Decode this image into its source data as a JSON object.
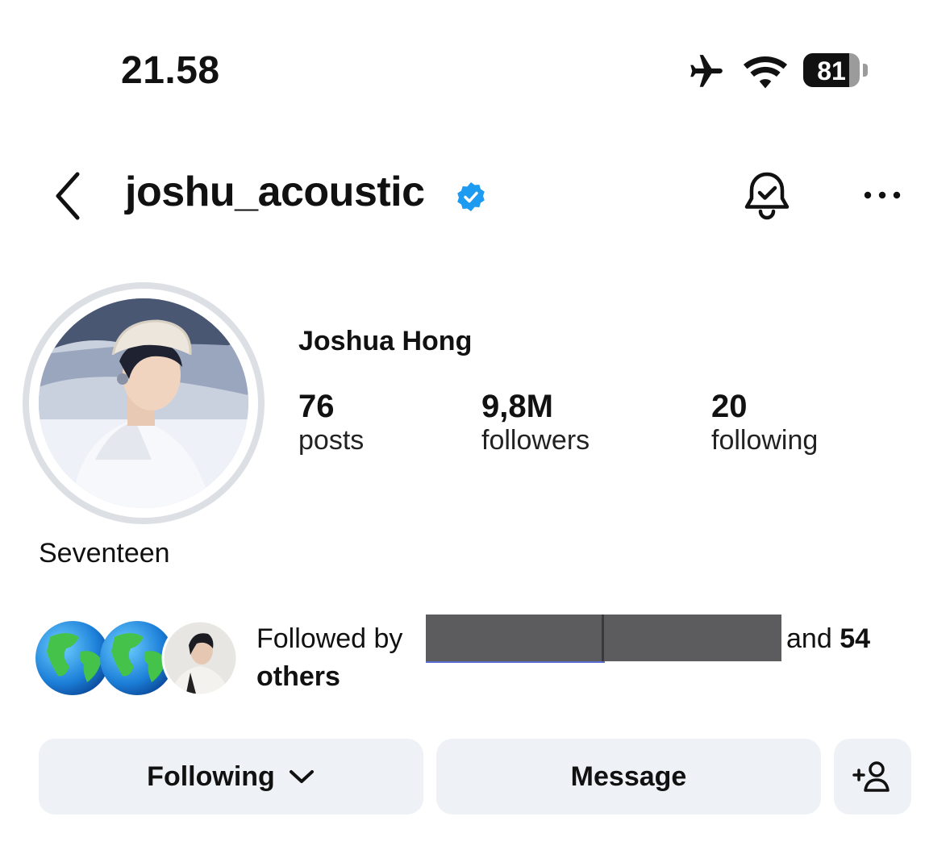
{
  "status_bar": {
    "time": "21.58",
    "battery_level": "81",
    "icons": [
      "airplane-icon",
      "wifi-icon",
      "battery-icon"
    ]
  },
  "header": {
    "username": "joshu_acoustic",
    "verified": true,
    "icons": [
      "back-chevron-icon",
      "verified-badge-icon",
      "notification-bell-icon",
      "more-options-icon"
    ]
  },
  "profile": {
    "name": "Joshua Hong",
    "bio": "Seventeen",
    "stats": [
      {
        "value": "76",
        "label": "posts"
      },
      {
        "value": "9,8M",
        "label": "followers"
      },
      {
        "value": "20",
        "label": "following"
      }
    ]
  },
  "followed_by": {
    "prefix": "Followed by",
    "and_text": "and",
    "count": "54",
    "others": "others",
    "avatars": [
      "globe-icon",
      "globe-icon",
      "user-photo"
    ]
  },
  "actions": {
    "following_label": "Following",
    "message_label": "Message",
    "icons": [
      "chevron-down-icon",
      "add-person-icon"
    ]
  },
  "colors": {
    "verified_blue": "#1d9bf0",
    "button_bg": "#eef1f5",
    "avatar_ring": "#dcdfe4"
  }
}
